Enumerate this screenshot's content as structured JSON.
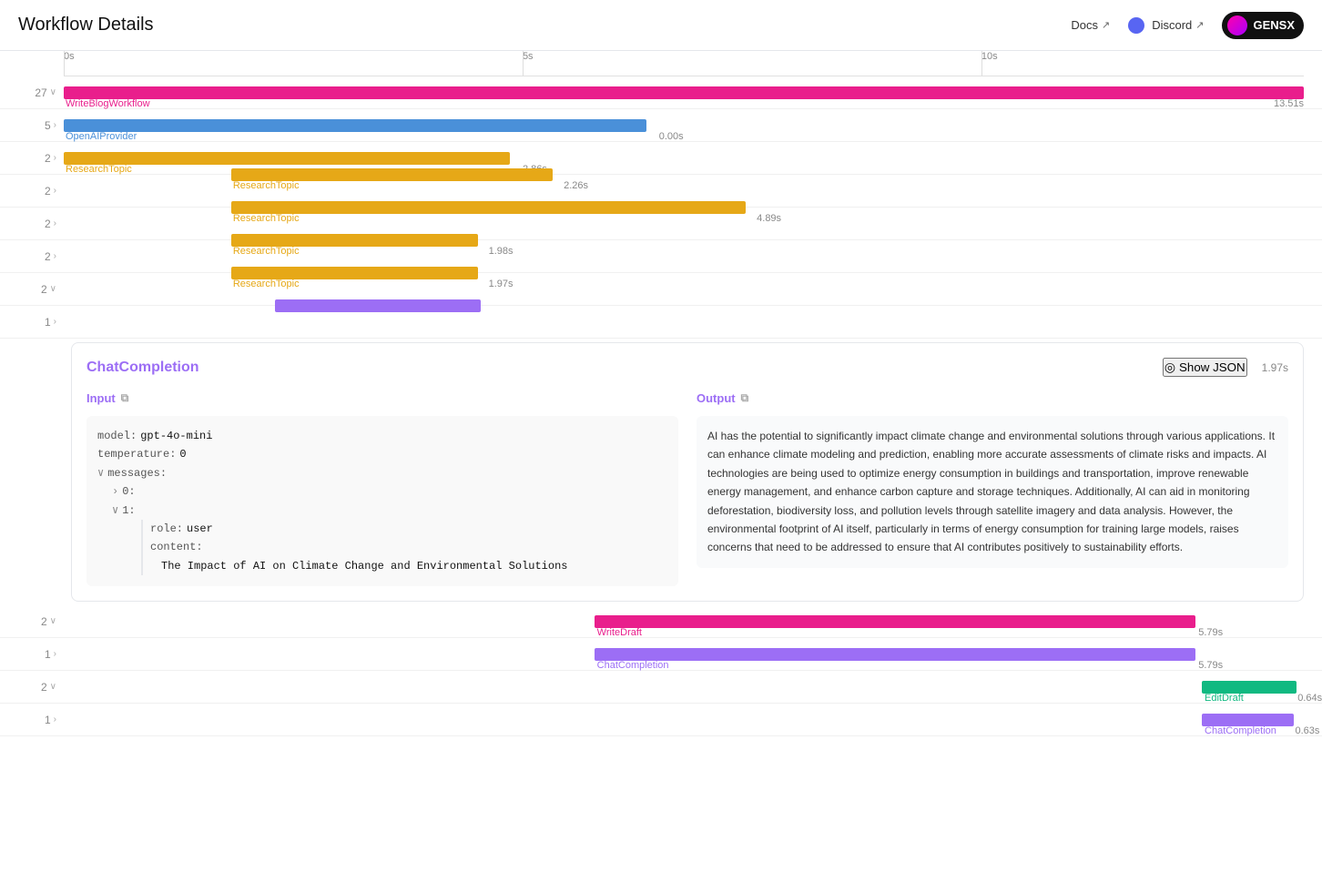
{
  "header": {
    "title": "Workflow Details",
    "docs_label": "Docs",
    "discord_label": "Discord",
    "gensx_label": "GENSX"
  },
  "ruler": {
    "labels": [
      "0s",
      "5s",
      "10s"
    ],
    "total_duration_s": 13.51
  },
  "gantt": {
    "rows": [
      {
        "id": "write-blog-workflow",
        "indent": 0,
        "label_count": "27",
        "label_expanded": true,
        "bar_color": "pink",
        "bar_start_pct": 0,
        "bar_width_pct": 100,
        "bar_name": "WriteBlogWorkflow",
        "bar_duration": "13.51s",
        "name_left_pct": 0,
        "duration_right": true
      },
      {
        "id": "openai-provider",
        "indent": 1,
        "label_count": "5",
        "label_expanded": false,
        "bar_color": "blue",
        "bar_start_pct": 0,
        "bar_width_pct": 47,
        "bar_name": "OpenAIProvider",
        "bar_duration": "0.00s",
        "name_left_pct": 0,
        "duration_right": false
      },
      {
        "id": "research-topic-1",
        "indent": 2,
        "label_count": "2",
        "label_expanded": false,
        "bar_color": "yellow",
        "bar_start_pct": 0,
        "bar_width_pct": 35.5,
        "bar_name": "ResearchTopic",
        "bar_duration": "2.86s",
        "name_left_pct": 0,
        "duration_right": false
      },
      {
        "id": "research-topic-2",
        "indent": 2,
        "label_count": "2",
        "label_expanded": false,
        "bar_color": "yellow",
        "bar_start_pct": 0,
        "bar_width_pct": 29,
        "bar_name": "ResearchTopic",
        "bar_duration": "2.26s",
        "name_left_pct": 0,
        "duration_right": false
      },
      {
        "id": "research-topic-3",
        "indent": 2,
        "label_count": "2",
        "label_expanded": false,
        "bar_color": "yellow",
        "bar_start_pct": 0,
        "bar_width_pct": 47,
        "bar_name": "ResearchTopic",
        "bar_duration": "4.89s",
        "name_left_pct": 0,
        "duration_right": false
      },
      {
        "id": "research-topic-4",
        "indent": 2,
        "label_count": "2",
        "label_expanded": false,
        "bar_color": "yellow",
        "bar_start_pct": 0,
        "bar_width_pct": 23,
        "bar_name": "ResearchTopic",
        "bar_duration": "1.98s",
        "name_left_pct": 0,
        "duration_right": false
      },
      {
        "id": "research-topic-5",
        "indent": 2,
        "label_count": "2",
        "label_expanded": true,
        "bar_color": "yellow",
        "bar_start_pct": 0,
        "bar_width_pct": 23,
        "bar_name": "ResearchTopic",
        "bar_duration": "1.97s",
        "name_left_pct": 0,
        "duration_right": false
      }
    ],
    "detail_panel": {
      "title": "ChatCompletion",
      "duration": "1.97s",
      "show_json_label": "Show JSON",
      "input_label": "Input",
      "output_label": "Output",
      "input": {
        "model_key": "model:",
        "model_val": "gpt-4o-mini",
        "temperature_key": "temperature:",
        "temperature_val": "0",
        "messages_key": "messages:",
        "msg_0_key": "0:",
        "msg_1_key": "1:",
        "role_key": "role:",
        "role_val": "user",
        "content_key": "content:",
        "content_val": "The Impact of AI on Climate Change and Environmental Solutions"
      },
      "output_text": "AI has the potential to significantly impact climate change and environmental solutions through various applications. It can enhance climate modeling and prediction, enabling more accurate assessments of climate risks and impacts. AI technologies are being used to optimize energy consumption in buildings and transportation, improve renewable energy management, and enhance carbon capture and storage techniques. Additionally, AI can aid in monitoring deforestation, biodiversity loss, and pollution levels through satellite imagery and data analysis. However, the environmental footprint of AI itself, particularly in terms of energy consumption for training large models, raises concerns that need to be addressed to ensure that AI contributes positively to sustainability efforts."
    },
    "bottom_rows": [
      {
        "id": "write-draft",
        "indent": 1,
        "label_count": "2",
        "label_expanded": true,
        "bar_color": "pink",
        "bar_start_pct": 42.8,
        "bar_width_pct": 48.5,
        "bar_name": "WriteDraft",
        "bar_duration": "5.79s"
      },
      {
        "id": "chat-completion-wd",
        "indent": 2,
        "label_count": "1",
        "label_expanded": false,
        "bar_color": "purple",
        "bar_start_pct": 42.8,
        "bar_width_pct": 48.5,
        "bar_name": "ChatCompletion",
        "bar_duration": "5.79s"
      },
      {
        "id": "edit-draft",
        "indent": 1,
        "label_count": "2",
        "label_expanded": true,
        "bar_color": "green",
        "bar_start_pct": 91.8,
        "bar_width_pct": 7.6,
        "bar_name": "EditDraft",
        "bar_duration": "0.64s"
      },
      {
        "id": "chat-completion-ed",
        "indent": 2,
        "label_count": "1",
        "label_expanded": false,
        "bar_color": "purple",
        "bar_start_pct": 91.8,
        "bar_width_pct": 7.4,
        "bar_name": "ChatCompletion",
        "bar_duration": "0.63s"
      }
    ]
  }
}
